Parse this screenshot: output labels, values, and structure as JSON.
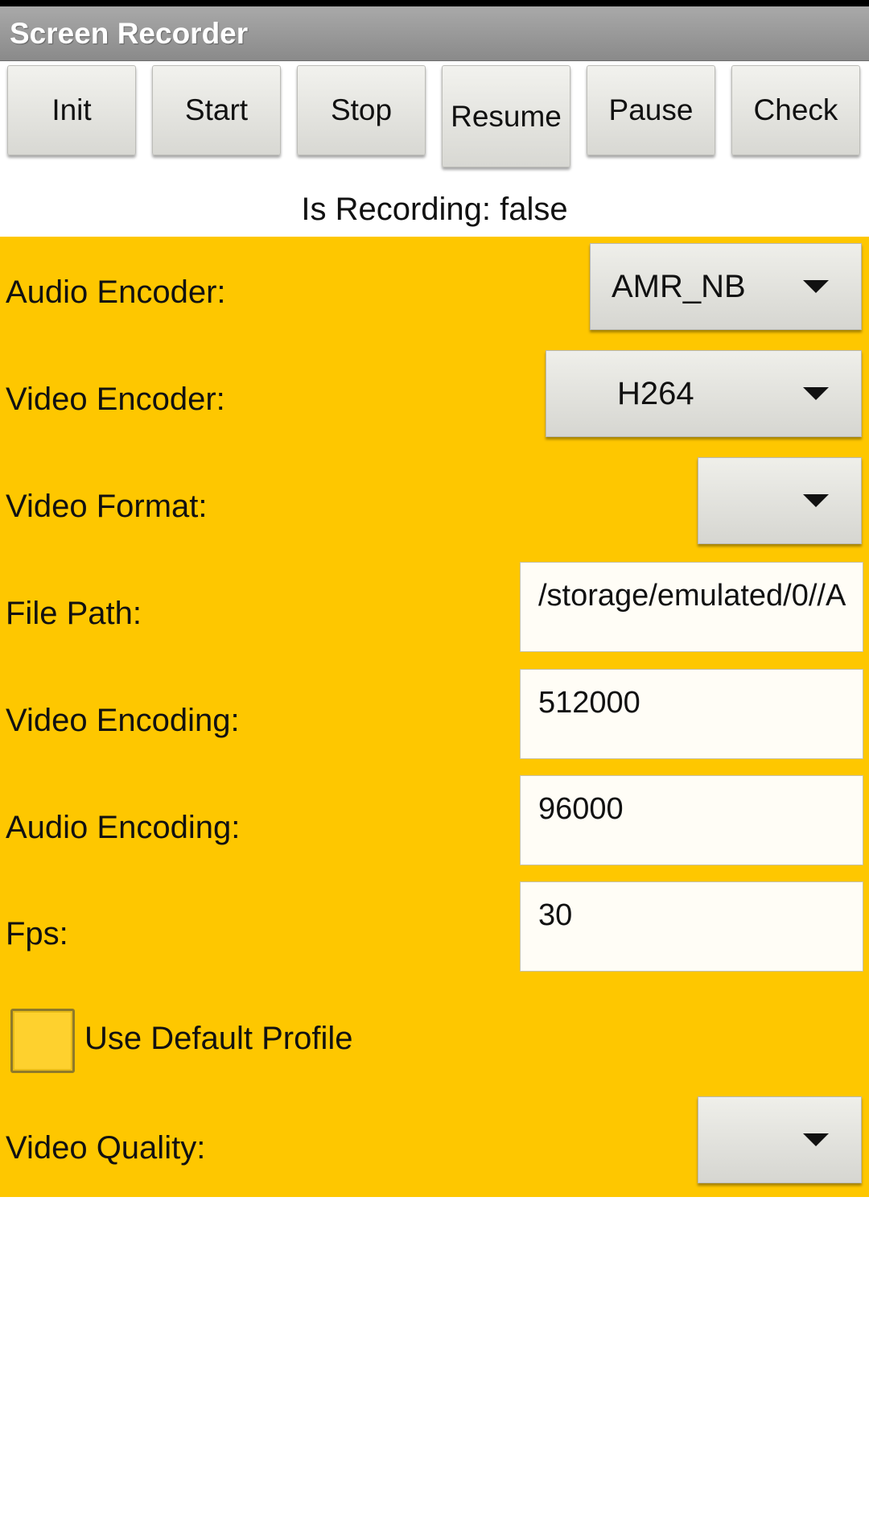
{
  "app": {
    "title": "Screen Recorder"
  },
  "buttons": {
    "init": "Init",
    "start": "Start",
    "stop": "Stop",
    "resume": "Resume",
    "pause": "Pause",
    "check": "Check"
  },
  "status": {
    "recording_text": "Is Recording: false"
  },
  "settings": {
    "audio_encoder": {
      "label": "Audio Encoder:",
      "value": "AMR_NB"
    },
    "video_encoder": {
      "label": "Video Encoder:",
      "value": "H264"
    },
    "video_format": {
      "label": "Video Format:",
      "value": ""
    },
    "file_path": {
      "label": "File Path:",
      "value": "/storage/emulated/0//A"
    },
    "video_encoding": {
      "label": "Video Encoding:",
      "value": "512000"
    },
    "audio_encoding": {
      "label": "Audio Encoding:",
      "value": "96000"
    },
    "fps": {
      "label": "Fps:",
      "value": "30"
    },
    "use_default_profile": {
      "label": "Use Default Profile",
      "checked": false
    },
    "video_quality": {
      "label": "Video Quality:",
      "value": ""
    }
  },
  "colors": {
    "panel_background": "#fec700",
    "titlebar": "#9a9a9a",
    "field_background": "#fffdf6"
  },
  "icons": {
    "spinner_arrow": "triangle-down-icon"
  }
}
